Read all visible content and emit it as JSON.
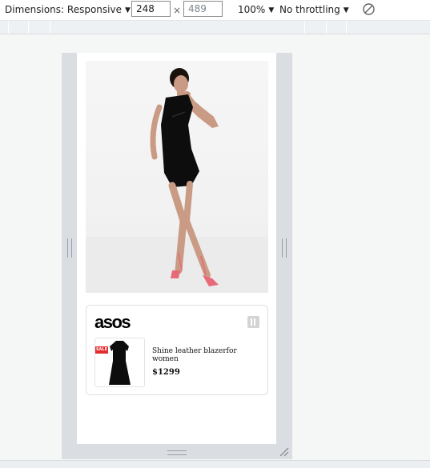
{
  "toolbar": {
    "dimensions_label": "Dimensions: Responsive",
    "width_value": "248",
    "times": "×",
    "height_value": "489",
    "zoom": "100%",
    "throttling": "No throttling",
    "caret": "▼",
    "rotate_icon": "rotate-icon"
  },
  "ad": {
    "brand": "asos",
    "info_icon": "info-icon",
    "sale_badge": "SALE",
    "product_title": "Shine leather blazerfor women",
    "price": "$1299"
  },
  "colors": {
    "frame": "#dadde1",
    "sale": "#e52b2b",
    "dress": "#0d0d0d",
    "heels": "#e86a78"
  }
}
